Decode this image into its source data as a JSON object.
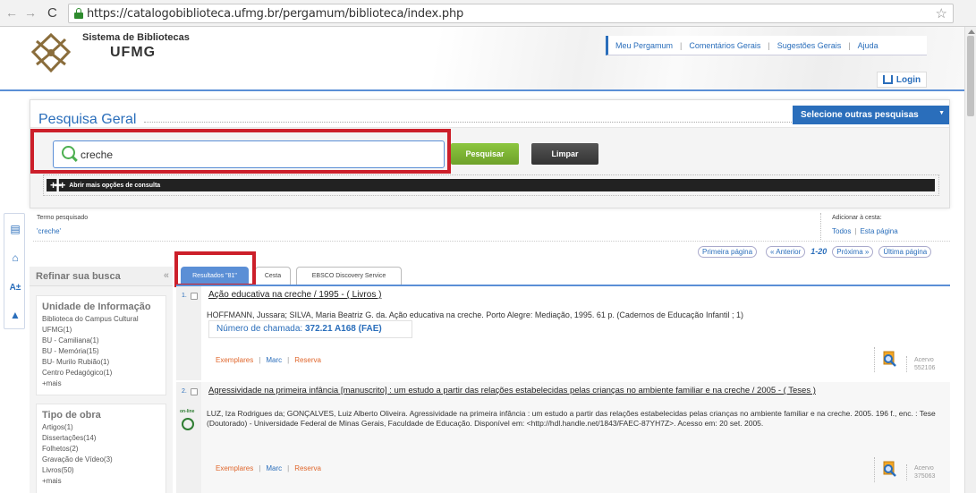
{
  "browser": {
    "url": "https://catalogobiblioteca.ufmg.br/pergamum/biblioteca/index.php",
    "back_glyph": "←",
    "forward_glyph": "→",
    "reload_glyph": "C",
    "bookmark_glyph": "☆"
  },
  "header": {
    "title_line1": "Sistema de Bibliotecas",
    "title_line2": "UFMG",
    "nav": [
      "Meu Pergamum",
      "Comentários Gerais",
      "Sugestões Gerais",
      "Ajuda"
    ],
    "login_label": "Login"
  },
  "search": {
    "title": "Pesquisa Geral",
    "other_searches_label": "Selecione outras pesquisas",
    "query": "creche",
    "search_button": "Pesquisar",
    "clear_button": "Limpar",
    "more_options": "Abrir mais opções de consulta"
  },
  "term": {
    "label": "Termo pesquisado",
    "value": "'creche'",
    "cart_label": "Adicionar à cesta:",
    "cart_all": "Todos",
    "cart_page": "Esta página"
  },
  "pager": {
    "first": "Primeira página",
    "prev": "« Anterior",
    "current": "1-20",
    "next": "Próxima »",
    "last": "Última página"
  },
  "refine": {
    "title": "Refinar sua busca",
    "collapse_glyph": "«",
    "facets": [
      {
        "title": "Unidade de Informação",
        "items": [
          "Biblioteca do Campus Cultural UFMG(1)",
          "BU - Camiliana(1)",
          "BU - Memória(15)",
          "BU- Murilo Rubião(1)",
          "Centro Pedagógico(1)"
        ],
        "more": "+mais"
      },
      {
        "title": "Tipo de obra",
        "items": [
          "Artigos(1)",
          "Dissertações(14)",
          "Folhetos(2)",
          "Gravação de Vídeo(3)",
          "Livros(50)"
        ],
        "more": "+mais"
      }
    ]
  },
  "tabs": [
    "Resultados \"81\"",
    "Cesta",
    "EBSCO Discovery Service"
  ],
  "results": [
    {
      "num": "1.",
      "title": "Ação educativa na creche / 1995 - ( Livros )",
      "reference": "HOFFMANN, Jussara; SILVA, Maria Beatriz G. da. Ação educativa na creche. Porto Alegre: Mediação, 1995. 61 p. (Cadernos de Educação Infantil ; 1)",
      "callno_label": "Número de chamada:",
      "callno": "372.21 A168 (FAE)",
      "actions": [
        "Exemplares",
        "Marc",
        "Reserva"
      ],
      "acervo_label": "Acervo",
      "acervo": "552106"
    },
    {
      "num": "2.",
      "title": "Agressividade na primeira infância [manuscrito] : um estudo a partir das relações estabelecidas pelas crianças no ambiente familiar e na creche / 2005 - ( Teses )",
      "online_badge": "on-line",
      "reference": "LUZ, Iza Rodrigues da; GONÇALVES, Luiz Alberto Oliveira. Agressividade na primeira infância : um estudo a partir das relações estabelecidas pelas crianças no ambiente familiar e na creche. 2005. 196 f., enc. : Tese (Doutorado) - Universidade Federal de Minas Gerais, Faculdade de Educação. Disponível em: <http://hdl.handle.net/1843/FAEC-87YH7Z>. Acesso em: 20 set. 2005.",
      "actions": [
        "Exemplares",
        "Marc",
        "Reserva"
      ],
      "acervo_label": "Acervo",
      "acervo": "375063"
    }
  ],
  "colors": {
    "accent": "#2a6ebb",
    "highlight": "#cc1f2a",
    "search_button": "#8cc63f",
    "action_link": "#e0672d"
  }
}
